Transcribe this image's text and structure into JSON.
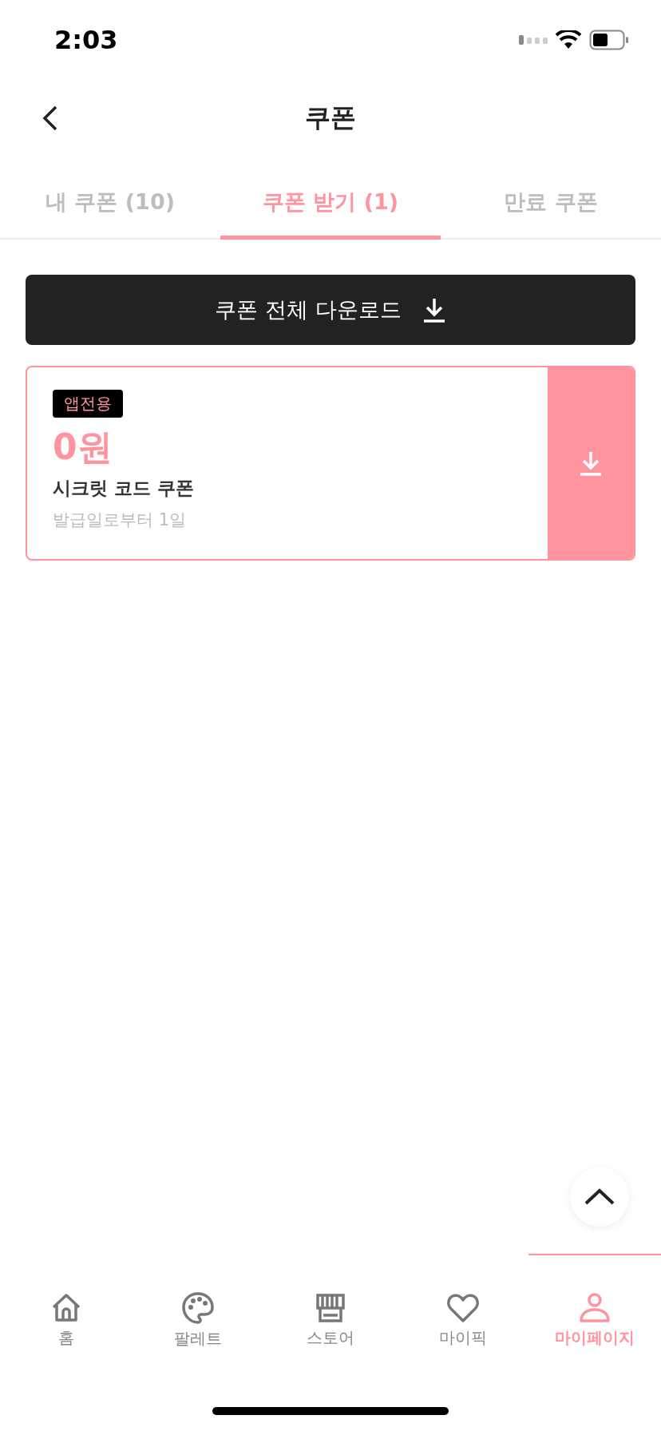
{
  "status_bar": {
    "time": "2:03"
  },
  "header": {
    "title": "쿠폰"
  },
  "tabs": [
    {
      "label": "내 쿠폰 (10)",
      "selected": false
    },
    {
      "label": "쿠폰 받기 (1)",
      "selected": true
    },
    {
      "label": "만료 쿠폰",
      "selected": false
    }
  ],
  "download_all_button": {
    "label": "쿠폰 전체 다운로드"
  },
  "coupons": [
    {
      "tag": "앱전용",
      "amount": "0원",
      "name": "시크릿 코드 쿠폰",
      "validity": "발급일로부터 1일"
    }
  ],
  "bottom_nav": [
    {
      "kind": "home",
      "label": "홈",
      "selected": false
    },
    {
      "kind": "palette",
      "label": "팔레트",
      "selected": false
    },
    {
      "kind": "store",
      "label": "스토어",
      "selected": false
    },
    {
      "kind": "heart",
      "label": "마이픽",
      "selected": false
    },
    {
      "kind": "person",
      "label": "마이페이지",
      "selected": true
    }
  ]
}
